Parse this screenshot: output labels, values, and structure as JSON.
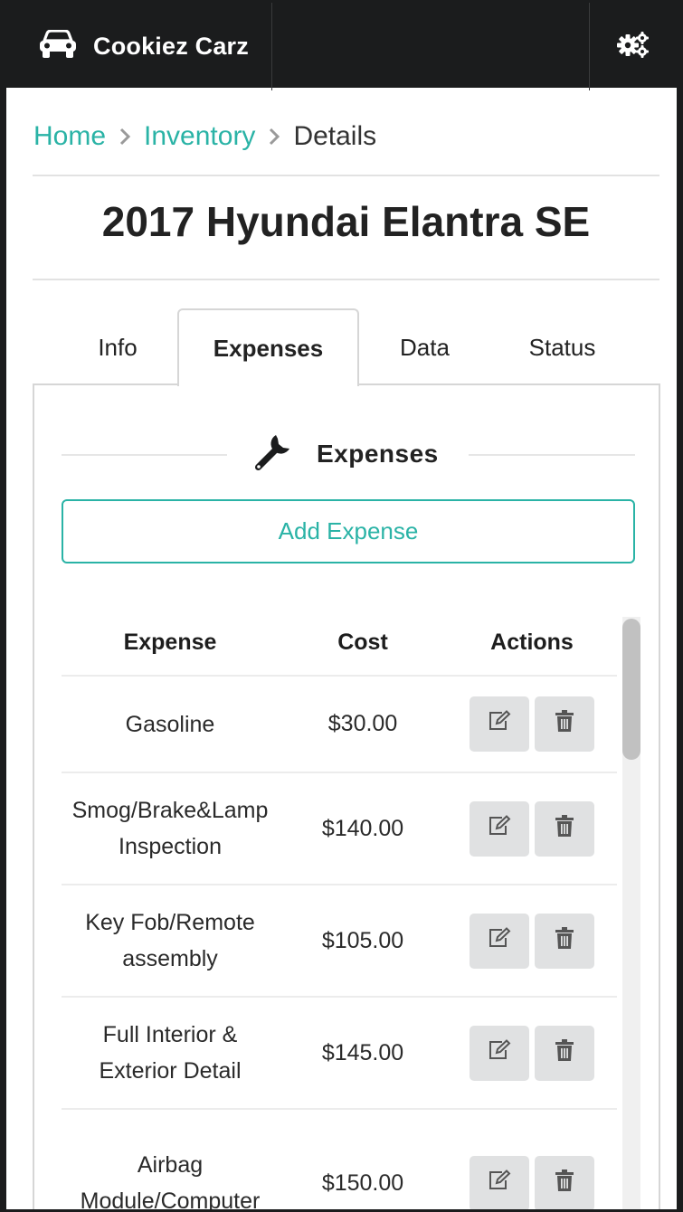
{
  "app": {
    "brand_name": "Cookiez Carz",
    "brand_icon": "car-icon",
    "settings_icon": "cogs-icon"
  },
  "breadcrumb": {
    "home": "Home",
    "inventory": "Inventory",
    "current": "Details"
  },
  "page_title": "2017 Hyundai Elantra SE",
  "tabs": [
    {
      "label": "Info",
      "active": false
    },
    {
      "label": "Expenses",
      "active": true
    },
    {
      "label": "Data",
      "active": false
    },
    {
      "label": "Status",
      "active": false
    }
  ],
  "expenses_section": {
    "title": "Expenses",
    "icon": "wrench-icon",
    "add_button": "Add Expense",
    "columns": {
      "expense": "Expense",
      "cost": "Cost",
      "actions": "Actions"
    },
    "rows": [
      {
        "expense": "Gasoline",
        "cost": "$30.00"
      },
      {
        "expense": "Smog/Brake&Lamp Inspection",
        "cost": "$140.00"
      },
      {
        "expense": "Key Fob/Remote assembly",
        "cost": "$105.00"
      },
      {
        "expense": "Full Interior & Exterior Detail",
        "cost": "$145.00"
      },
      {
        "expense": "Airbag Module/Computer",
        "cost": "$150.00"
      }
    ]
  },
  "colors": {
    "accent": "#2ab3a6",
    "topbar": "#1b1c1d",
    "button_gray": "#e0e1e2"
  }
}
